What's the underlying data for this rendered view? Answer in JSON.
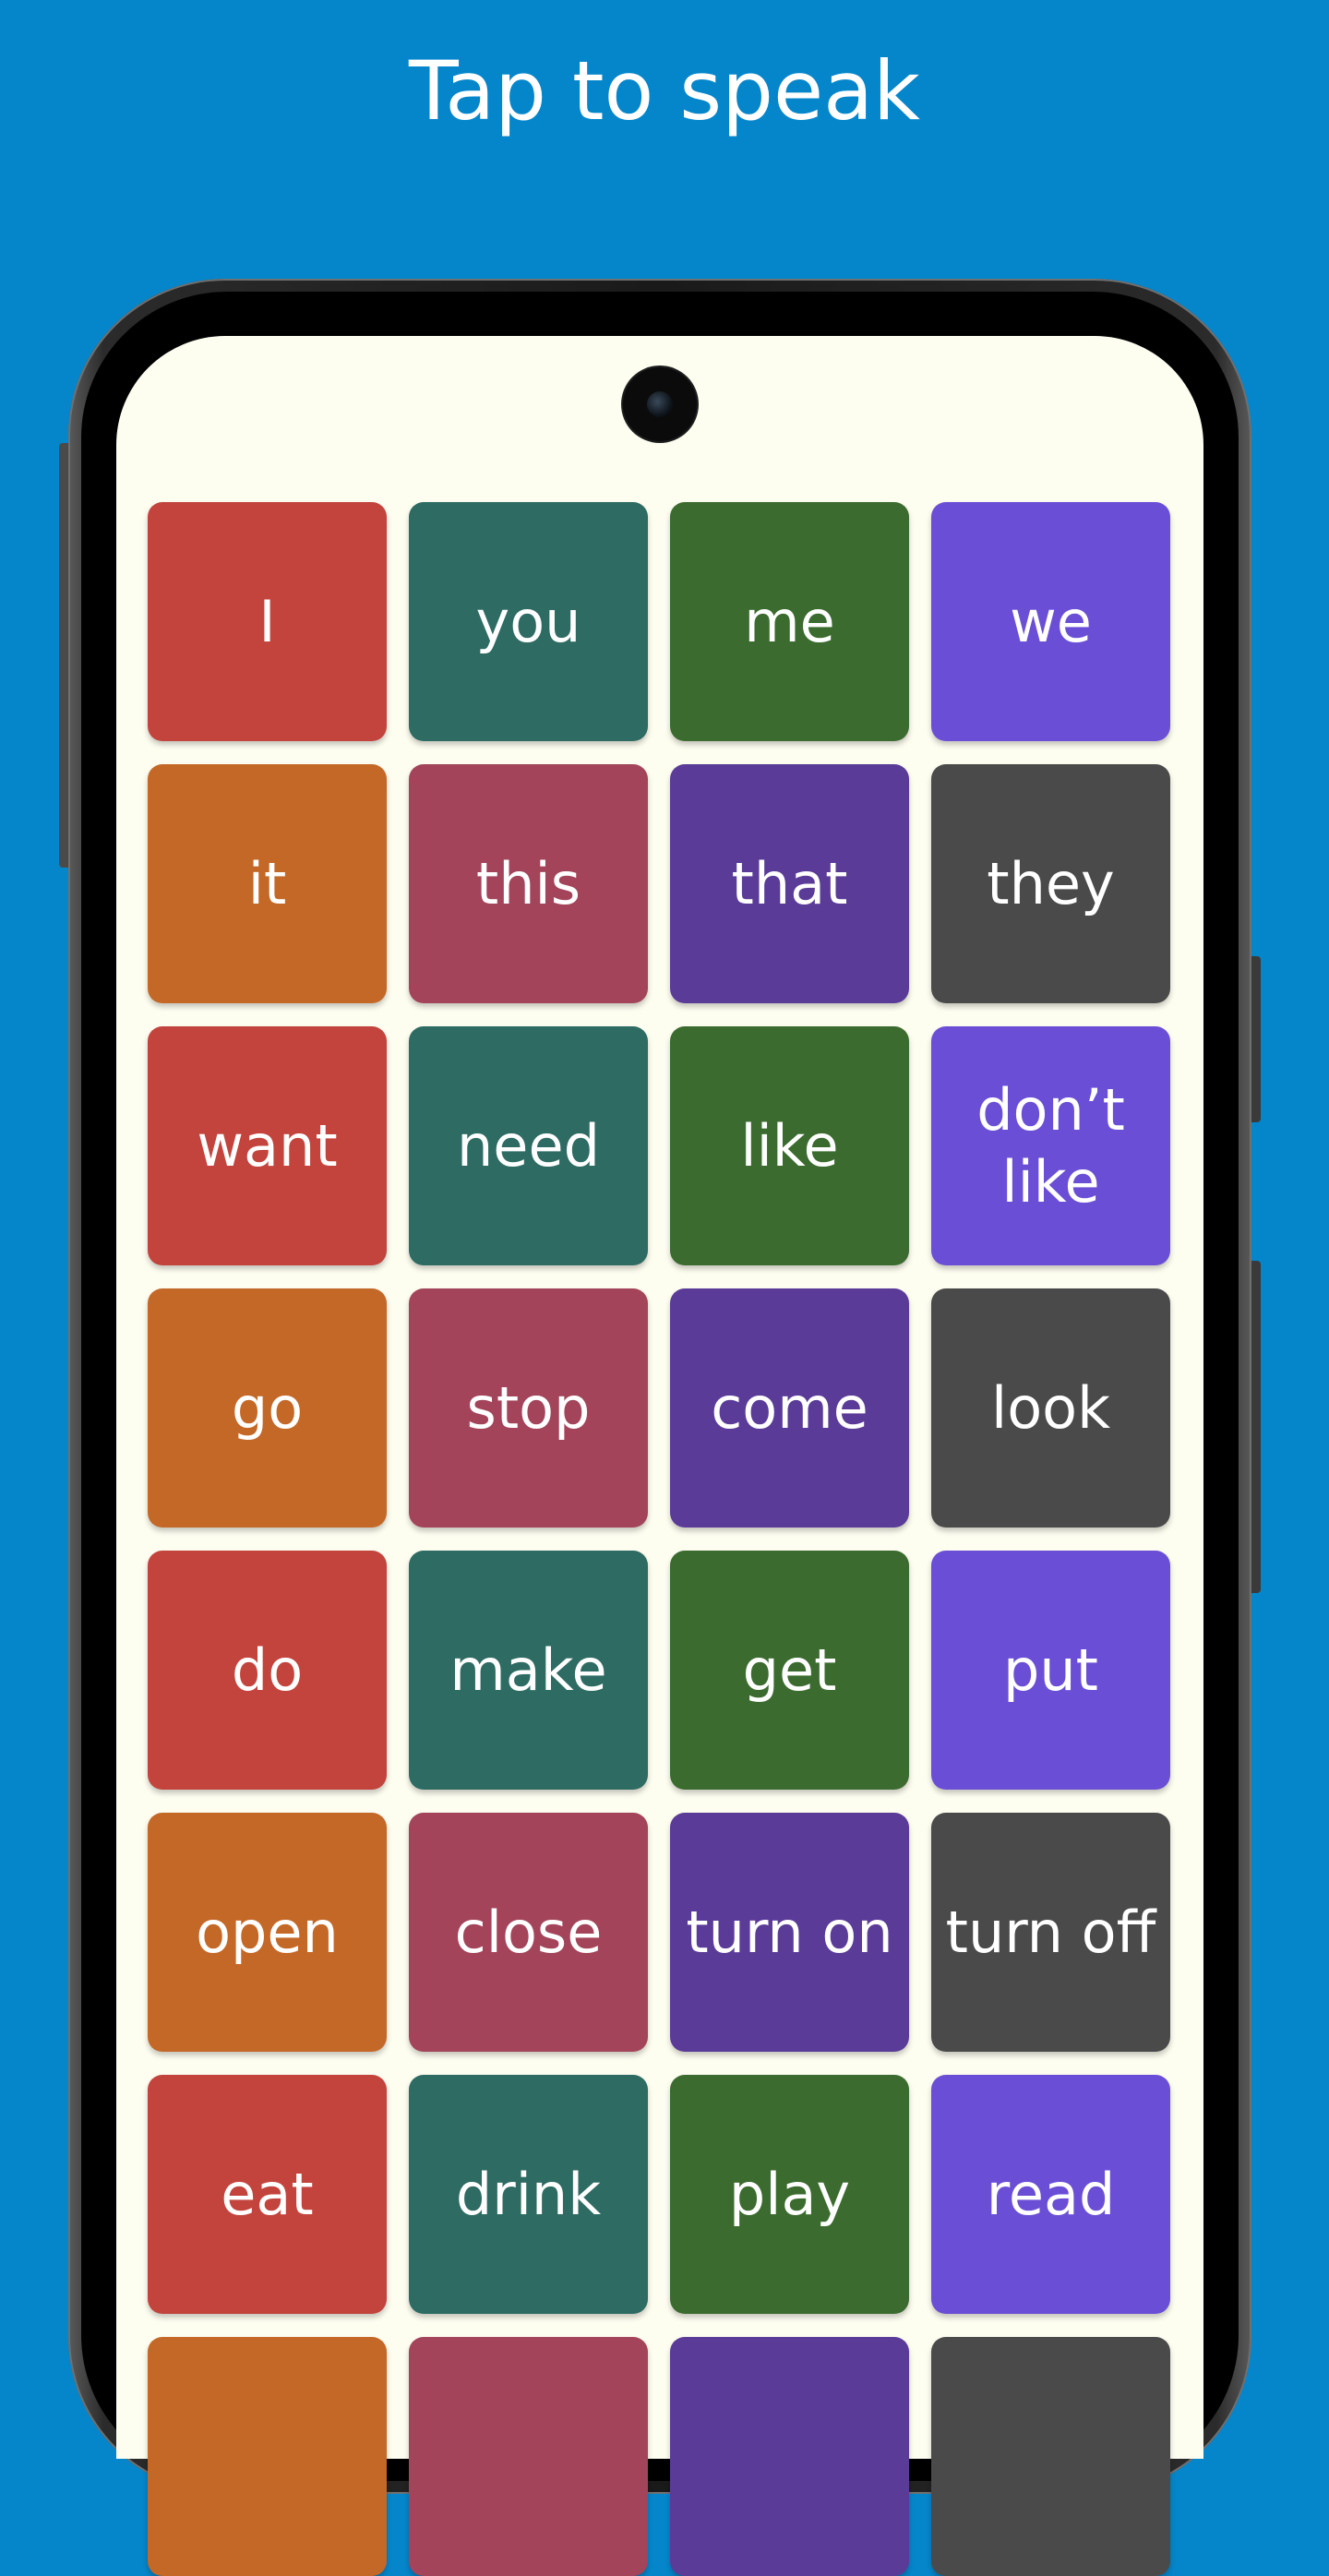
{
  "header": {
    "title": "Tap to speak"
  },
  "colors": {
    "background": "#0586cb",
    "screen": "#fdfdf0",
    "red": "#c2443d",
    "teal": "#2e6b62",
    "green": "#3b6b2f",
    "violet": "#6b4ed6",
    "orange": "#c46827",
    "rose": "#a3445a",
    "purple": "#5a3b98",
    "gray": "#4a4a4a"
  },
  "tiles": [
    {
      "label": "I",
      "color": "red"
    },
    {
      "label": "you",
      "color": "teal"
    },
    {
      "label": "me",
      "color": "green"
    },
    {
      "label": "we",
      "color": "violet"
    },
    {
      "label": "it",
      "color": "orange"
    },
    {
      "label": "this",
      "color": "rose"
    },
    {
      "label": "that",
      "color": "purple"
    },
    {
      "label": "they",
      "color": "gray"
    },
    {
      "label": "want",
      "color": "red"
    },
    {
      "label": "need",
      "color": "teal"
    },
    {
      "label": "like",
      "color": "green"
    },
    {
      "label": "don’t\nlike",
      "color": "violet"
    },
    {
      "label": "go",
      "color": "orange"
    },
    {
      "label": "stop",
      "color": "rose"
    },
    {
      "label": "come",
      "color": "purple"
    },
    {
      "label": "look",
      "color": "gray"
    },
    {
      "label": "do",
      "color": "red"
    },
    {
      "label": "make",
      "color": "teal"
    },
    {
      "label": "get",
      "color": "green"
    },
    {
      "label": "put",
      "color": "violet"
    },
    {
      "label": "open",
      "color": "orange"
    },
    {
      "label": "close",
      "color": "rose"
    },
    {
      "label": "turn on",
      "color": "purple"
    },
    {
      "label": "turn off",
      "color": "gray"
    },
    {
      "label": "eat",
      "color": "red"
    },
    {
      "label": "drink",
      "color": "teal"
    },
    {
      "label": "play",
      "color": "green"
    },
    {
      "label": "read",
      "color": "violet"
    },
    {
      "label": "",
      "color": "orange"
    },
    {
      "label": "",
      "color": "rose"
    },
    {
      "label": "",
      "color": "purple"
    },
    {
      "label": "",
      "color": "gray"
    }
  ]
}
